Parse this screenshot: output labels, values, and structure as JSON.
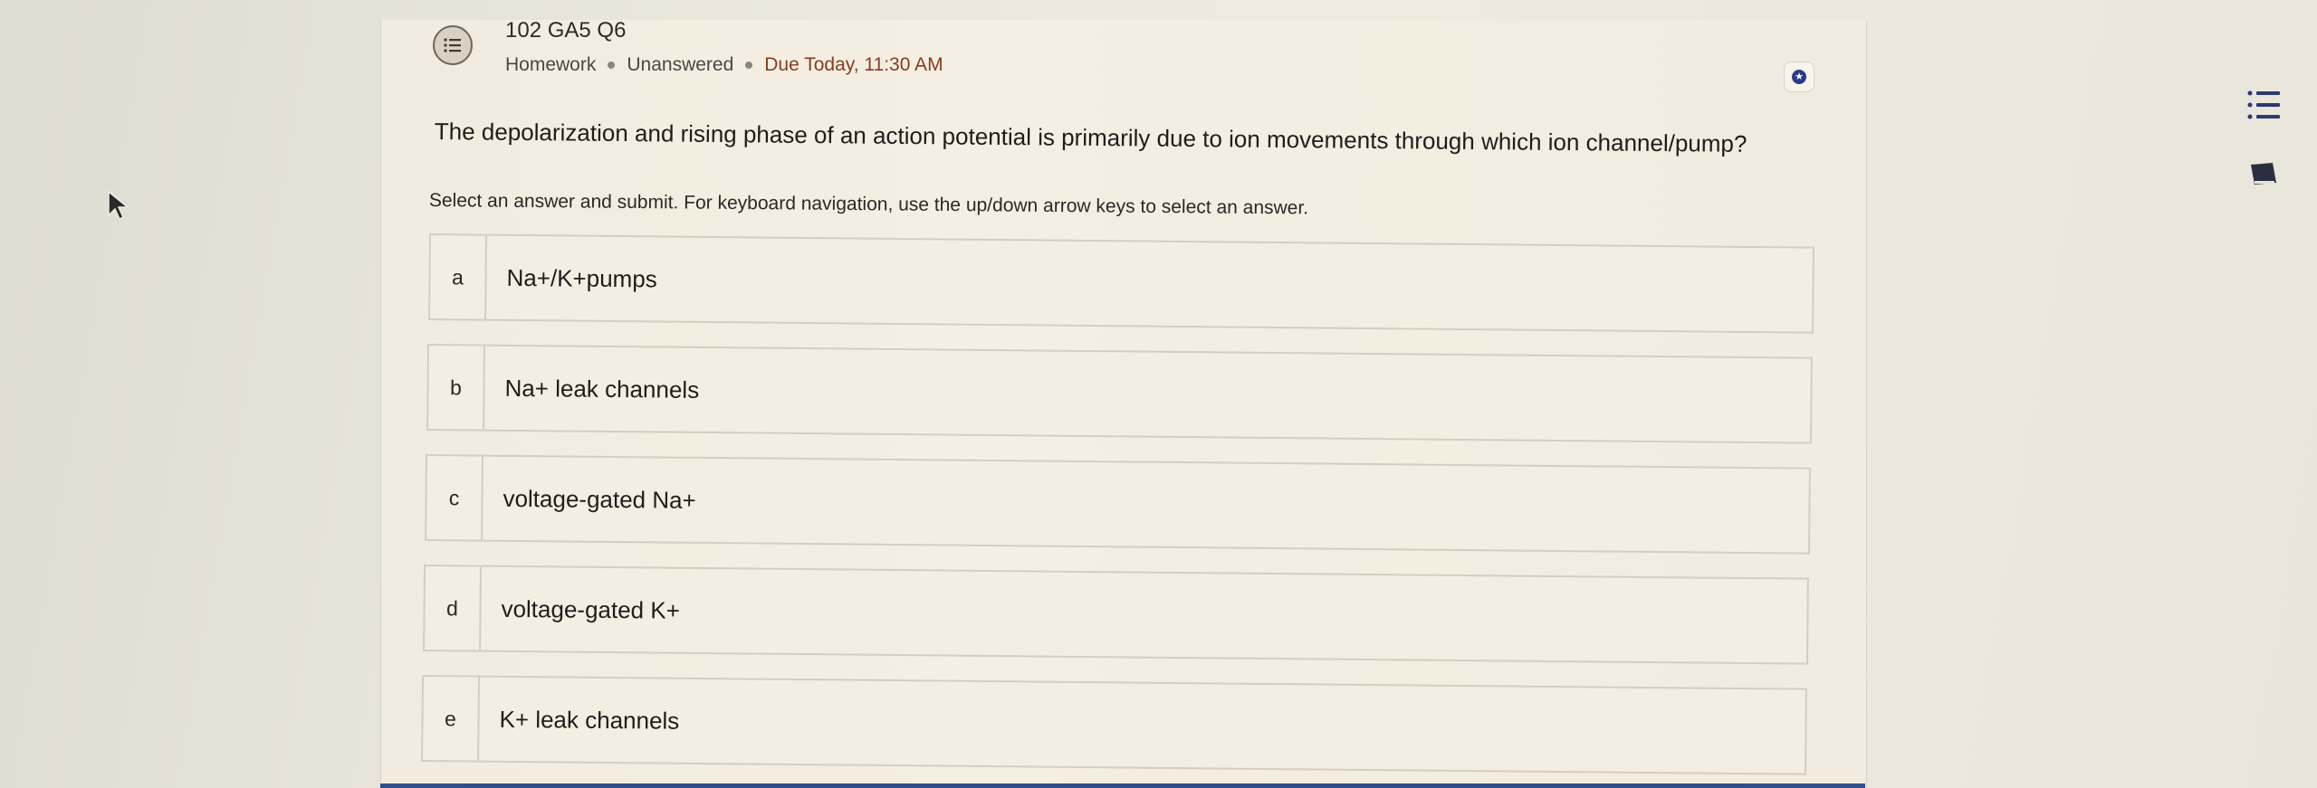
{
  "question_header": {
    "title": "102 GA5 Q6",
    "type": "Homework",
    "status": "Unanswered",
    "due": "Due Today, 11:30 AM"
  },
  "question": {
    "text": "The depolarization and rising phase of an action potential is primarily due to ion movements through which ion channel/pump?",
    "instructions": "Select an answer and submit. For keyboard navigation, use the up/down arrow keys to select an answer."
  },
  "options": [
    {
      "letter": "a",
      "text": "Na+/K+pumps"
    },
    {
      "letter": "b",
      "text": "Na+ leak channels"
    },
    {
      "letter": "c",
      "text": "voltage-gated Na+"
    },
    {
      "letter": "d",
      "text": "voltage-gated K+"
    },
    {
      "letter": "e",
      "text": "K+ leak channels"
    }
  ],
  "icons": {
    "question_type": "list-bubble-icon",
    "badge": "star-badge-icon",
    "side_menu": "list-menu-icon",
    "side_notes": "notebook-icon",
    "cursor": "mouse-pointer-icon"
  },
  "colors": {
    "accent": "#2a3a8c",
    "due": "#8a3a1e",
    "bottom_bar": "#2f4f8f"
  }
}
